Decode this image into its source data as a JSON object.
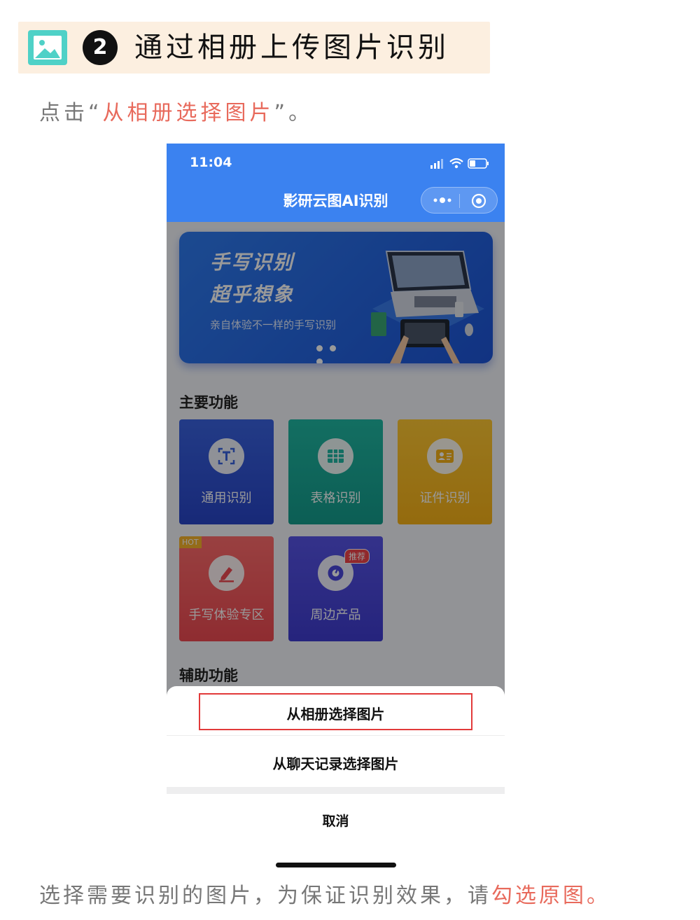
{
  "header": {
    "step_number": "2",
    "title": "通过相册上传图片识别",
    "icon": "image-icon"
  },
  "instruction_top": {
    "prefix": "点击“",
    "highlight": "从相册选择图片",
    "suffix": "”。"
  },
  "instruction_bottom": {
    "prefix": "选择需要识别的图片，为保证识别效果，请",
    "highlight": "勾选原图",
    "suffix": "。"
  },
  "phone": {
    "status_time": "11:04",
    "app_title": "影研云图AI识别",
    "banner": {
      "line1": "手写识别",
      "line2": "超乎想象",
      "subtitle": "亲自体验不一样的手写识别"
    },
    "main_section_title": "主要功能",
    "tiles": [
      {
        "label": "通用识别",
        "icon": "text-scan-icon"
      },
      {
        "label": "表格识别",
        "icon": "table-icon"
      },
      {
        "label": "证件识别",
        "icon": "id-card-icon"
      },
      {
        "label": "手写体验专区",
        "icon": "pen-icon",
        "badge": "HOT"
      },
      {
        "label": "周边产品",
        "icon": "product-icon",
        "badge": "推荐"
      }
    ],
    "aux_section_title": "辅助功能",
    "action_sheet": {
      "option1": "从相册选择图片",
      "option2": "从聊天记录选择图片",
      "cancel": "取消"
    }
  },
  "colors": {
    "accent_red": "#e86a5c",
    "header_bg": "#fcefe0",
    "app_blue": "#3b82f0"
  }
}
